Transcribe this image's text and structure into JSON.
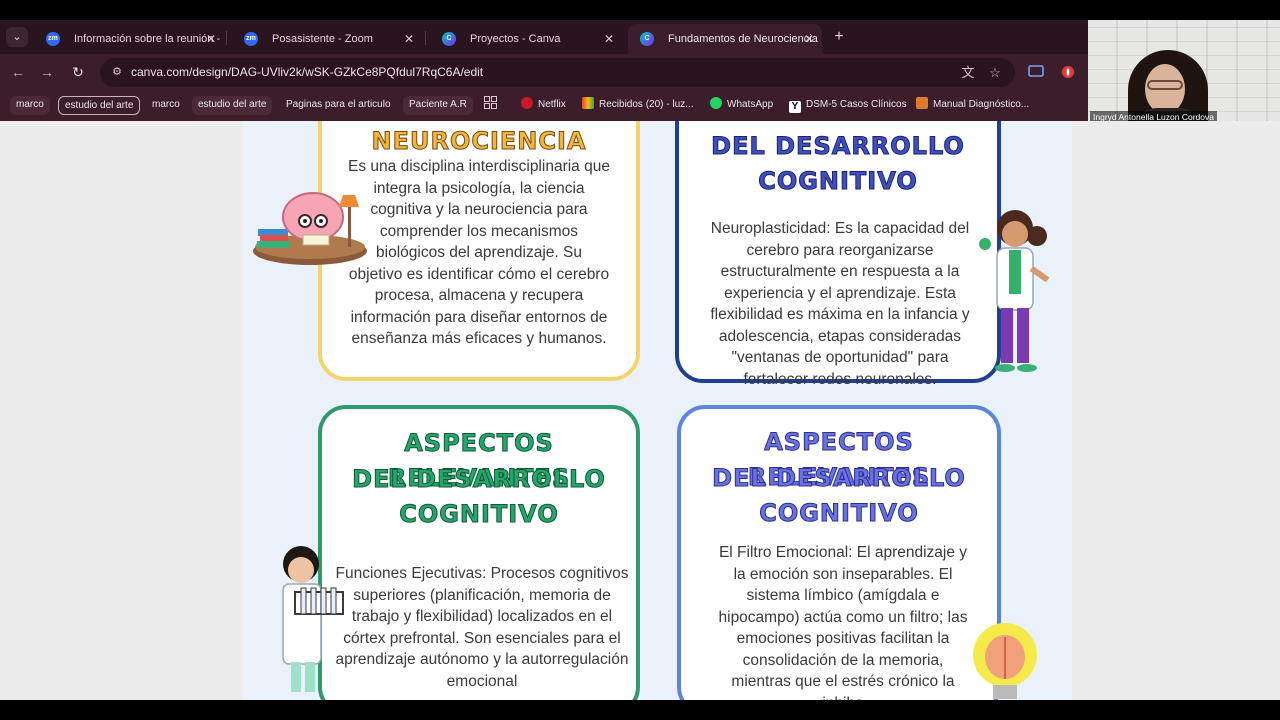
{
  "browser": {
    "tabs": [
      {
        "label": "Información sobre la reunión -",
        "favicon": "zoom-icon",
        "favicon_text": "zm",
        "active": false
      },
      {
        "label": "Posasistente - Zoom",
        "favicon": "zoom-icon",
        "favicon_text": "zm",
        "active": false
      },
      {
        "label": "Proyectos - Canva",
        "favicon": "canva-icon",
        "favicon_text": "C",
        "active": false
      },
      {
        "label": "Fundamentos de Neurociencia",
        "favicon": "canva-icon",
        "favicon_text": "C",
        "active": true
      }
    ],
    "url": "canva.com/design/DAG-UVliv2k/wSK-GZkCe8PQfdul7RqC6A/edit",
    "bookmarks": [
      {
        "label": "marco",
        "style": "pill"
      },
      {
        "label": "estudio del arte",
        "style": "pill-outline"
      },
      {
        "label": "marco",
        "style": "plain"
      },
      {
        "label": "estudio del arte",
        "style": "pill"
      },
      {
        "label": "Paginas para el articulo",
        "style": "plain"
      },
      {
        "label": "Paciente A.R",
        "style": "pill"
      },
      {
        "label": "Netflix",
        "icon": "netflix-icon"
      },
      {
        "label": "Recibidos (20) - luz...",
        "icon": "gmail-icon"
      },
      {
        "label": "WhatsApp",
        "icon": "whatsapp-icon"
      },
      {
        "label": "DSM-5 Casos Clínicos",
        "icon": "y-icon"
      },
      {
        "label": "Manual Diagnóstico...",
        "icon": "manual-icon"
      }
    ],
    "colors": {
      "tabstrip": "#2a1420",
      "toolbar": "#3b1d2b"
    }
  },
  "webcam": {
    "participant_name": "Ingryd Antonella Luzon Cordova"
  },
  "design": {
    "cards": [
      {
        "title": "NEUROCIENCIA",
        "text": "Es una disciplina interdisciplinaria que integra la psicología, la ciencia cognitiva y la neurociencia para comprender los mecanismos biológicos del aprendizaje. Su objetivo es identificar cómo el cerebro procesa, almacena y recupera información para diseñar entornos de enseñanza más eficaces y humanos.",
        "color": "#f4d46a"
      },
      {
        "title_line1": "DEL DESARROLLO",
        "title_line2": "COGNITIVO",
        "text": "Neuroplasticidad: Es la capacidad del cerebro para reorganizarse estructuralmente en respuesta a la experiencia y el aprendizaje. Esta flexibilidad es máxima en la infancia y adolescencia, etapas consideradas \"ventanas de oportunidad\" para fortalecer redes neuronales.",
        "color": "#1f3f94"
      },
      {
        "title_line1": "ASPECTOS RELEVANTES",
        "title_line2": "DEL DESARROLLO",
        "title_line3": "COGNITIVO",
        "text": "Funciones Ejecutivas: Procesos cognitivos superiores (planificación, memoria de trabajo y flexibilidad) localizados en el córtex prefrontal. Son esenciales para el aprendizaje autónomo y la autorregulación emocional",
        "color": "#2e9a6c"
      },
      {
        "title_line1": "ASPECTOS RELEVANTES",
        "title_line2": "DEL DESARROLLO",
        "title_line3": "COGNITIVO",
        "text": "El Filtro Emocional: El aprendizaje y la emoción son inseparables. El sistema límbico (amígdala e hipocampo) actúa como un filtro; las emociones positivas facilitan la consolidación de la memoria, mientras que el estrés crónico la inhibe",
        "color": "#5b85d6"
      }
    ]
  }
}
